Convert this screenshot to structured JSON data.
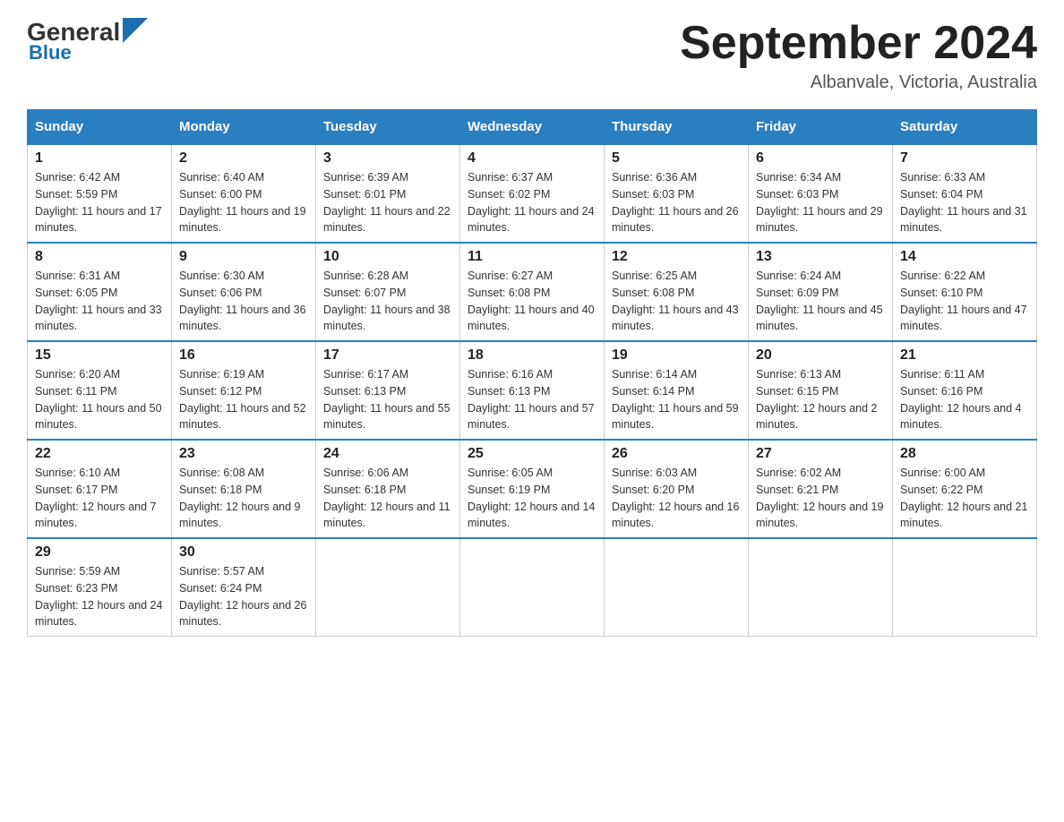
{
  "header": {
    "logo_general": "General",
    "logo_blue": "Blue",
    "month_title": "September 2024",
    "location": "Albanvale, Victoria, Australia"
  },
  "days_of_week": [
    "Sunday",
    "Monday",
    "Tuesday",
    "Wednesday",
    "Thursday",
    "Friday",
    "Saturday"
  ],
  "weeks": [
    [
      {
        "day": "1",
        "sunrise": "6:42 AM",
        "sunset": "5:59 PM",
        "daylight": "11 hours and 17 minutes."
      },
      {
        "day": "2",
        "sunrise": "6:40 AM",
        "sunset": "6:00 PM",
        "daylight": "11 hours and 19 minutes."
      },
      {
        "day": "3",
        "sunrise": "6:39 AM",
        "sunset": "6:01 PM",
        "daylight": "11 hours and 22 minutes."
      },
      {
        "day": "4",
        "sunrise": "6:37 AM",
        "sunset": "6:02 PM",
        "daylight": "11 hours and 24 minutes."
      },
      {
        "day": "5",
        "sunrise": "6:36 AM",
        "sunset": "6:03 PM",
        "daylight": "11 hours and 26 minutes."
      },
      {
        "day": "6",
        "sunrise": "6:34 AM",
        "sunset": "6:03 PM",
        "daylight": "11 hours and 29 minutes."
      },
      {
        "day": "7",
        "sunrise": "6:33 AM",
        "sunset": "6:04 PM",
        "daylight": "11 hours and 31 minutes."
      }
    ],
    [
      {
        "day": "8",
        "sunrise": "6:31 AM",
        "sunset": "6:05 PM",
        "daylight": "11 hours and 33 minutes."
      },
      {
        "day": "9",
        "sunrise": "6:30 AM",
        "sunset": "6:06 PM",
        "daylight": "11 hours and 36 minutes."
      },
      {
        "day": "10",
        "sunrise": "6:28 AM",
        "sunset": "6:07 PM",
        "daylight": "11 hours and 38 minutes."
      },
      {
        "day": "11",
        "sunrise": "6:27 AM",
        "sunset": "6:08 PM",
        "daylight": "11 hours and 40 minutes."
      },
      {
        "day": "12",
        "sunrise": "6:25 AM",
        "sunset": "6:08 PM",
        "daylight": "11 hours and 43 minutes."
      },
      {
        "day": "13",
        "sunrise": "6:24 AM",
        "sunset": "6:09 PM",
        "daylight": "11 hours and 45 minutes."
      },
      {
        "day": "14",
        "sunrise": "6:22 AM",
        "sunset": "6:10 PM",
        "daylight": "11 hours and 47 minutes."
      }
    ],
    [
      {
        "day": "15",
        "sunrise": "6:20 AM",
        "sunset": "6:11 PM",
        "daylight": "11 hours and 50 minutes."
      },
      {
        "day": "16",
        "sunrise": "6:19 AM",
        "sunset": "6:12 PM",
        "daylight": "11 hours and 52 minutes."
      },
      {
        "day": "17",
        "sunrise": "6:17 AM",
        "sunset": "6:13 PM",
        "daylight": "11 hours and 55 minutes."
      },
      {
        "day": "18",
        "sunrise": "6:16 AM",
        "sunset": "6:13 PM",
        "daylight": "11 hours and 57 minutes."
      },
      {
        "day": "19",
        "sunrise": "6:14 AM",
        "sunset": "6:14 PM",
        "daylight": "11 hours and 59 minutes."
      },
      {
        "day": "20",
        "sunrise": "6:13 AM",
        "sunset": "6:15 PM",
        "daylight": "12 hours and 2 minutes."
      },
      {
        "day": "21",
        "sunrise": "6:11 AM",
        "sunset": "6:16 PM",
        "daylight": "12 hours and 4 minutes."
      }
    ],
    [
      {
        "day": "22",
        "sunrise": "6:10 AM",
        "sunset": "6:17 PM",
        "daylight": "12 hours and 7 minutes."
      },
      {
        "day": "23",
        "sunrise": "6:08 AM",
        "sunset": "6:18 PM",
        "daylight": "12 hours and 9 minutes."
      },
      {
        "day": "24",
        "sunrise": "6:06 AM",
        "sunset": "6:18 PM",
        "daylight": "12 hours and 11 minutes."
      },
      {
        "day": "25",
        "sunrise": "6:05 AM",
        "sunset": "6:19 PM",
        "daylight": "12 hours and 14 minutes."
      },
      {
        "day": "26",
        "sunrise": "6:03 AM",
        "sunset": "6:20 PM",
        "daylight": "12 hours and 16 minutes."
      },
      {
        "day": "27",
        "sunrise": "6:02 AM",
        "sunset": "6:21 PM",
        "daylight": "12 hours and 19 minutes."
      },
      {
        "day": "28",
        "sunrise": "6:00 AM",
        "sunset": "6:22 PM",
        "daylight": "12 hours and 21 minutes."
      }
    ],
    [
      {
        "day": "29",
        "sunrise": "5:59 AM",
        "sunset": "6:23 PM",
        "daylight": "12 hours and 24 minutes."
      },
      {
        "day": "30",
        "sunrise": "5:57 AM",
        "sunset": "6:24 PM",
        "daylight": "12 hours and 26 minutes."
      },
      null,
      null,
      null,
      null,
      null
    ]
  ]
}
